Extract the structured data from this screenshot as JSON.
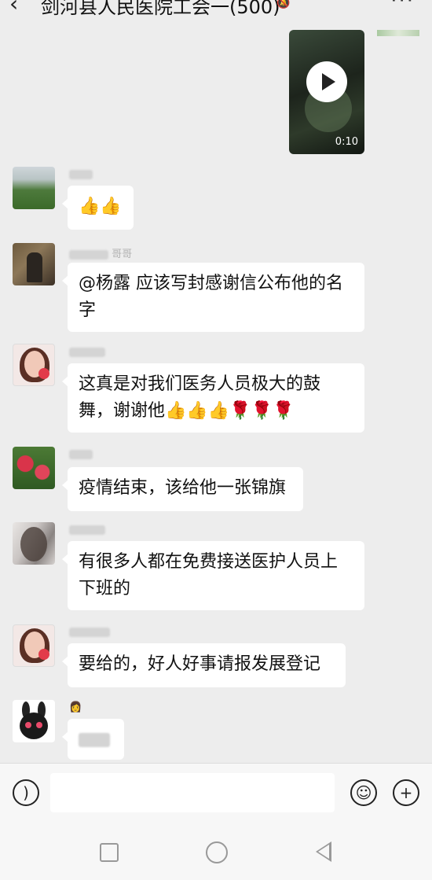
{
  "header": {
    "back_icon": "chevron-left-icon",
    "title": "剑河县人民医院工会一(500)",
    "mute_icon": "bell-off-icon",
    "more": "···"
  },
  "video": {
    "duration": "0:10",
    "icon": "play-icon"
  },
  "messages": [
    {
      "name": "",
      "text": "👍👍"
    },
    {
      "name": "哥哥",
      "text": "@杨露  应该写封感谢信公布他的名字"
    },
    {
      "name": "",
      "text": "这真是对我们医务人员极大的鼓舞，谢谢他👍👍👍🌹🌹🌹"
    },
    {
      "name": "",
      "text": "疫情结束，该给他一张锦旗"
    },
    {
      "name": "",
      "text": "有很多人都在免费接送医护人员上下班的"
    },
    {
      "name": "",
      "text": "要给的，好人好事请报发展登记"
    },
    {
      "name": "👩",
      "text": ""
    }
  ],
  "input": {
    "voice_icon": "voice-icon",
    "emoji_icon": "emoji-icon",
    "plus_icon": "plus-icon",
    "value": ""
  },
  "navbar": {
    "icons": [
      "square-nav-icon",
      "circle-nav-icon",
      "triangle-back-icon"
    ]
  }
}
